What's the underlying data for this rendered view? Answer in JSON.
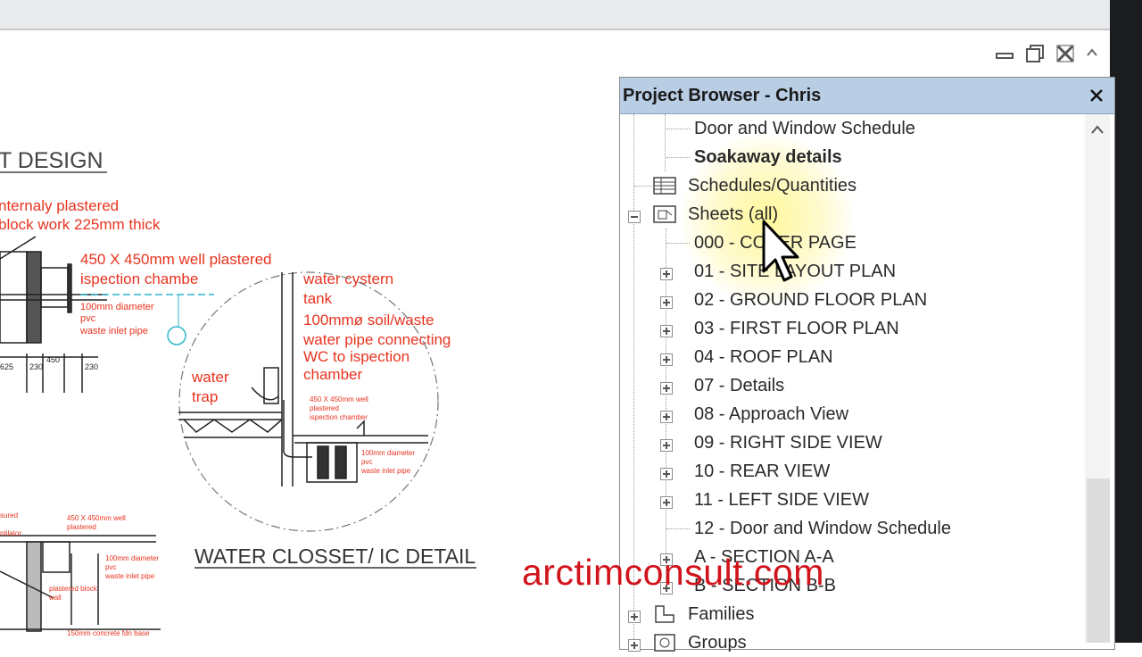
{
  "drawing": {
    "title_partial": "T DESIGN",
    "notes": [
      "nternaly plastered",
      "block work 225mm thick",
      "450 X 450mm well plastered",
      "ispection chambe",
      "100mm diameter",
      "pvc",
      "waste inlet pipe",
      "water cystern",
      "tank",
      "100mmø soil/waste",
      "water pipe connecting",
      "WC to ispection",
      "chamber",
      "water",
      "trap",
      "450 X 450mm well",
      "plastered",
      "ispection chamber",
      "100mm diameter",
      "pvc",
      "waste inlet pipe"
    ],
    "detail_title": "WATER CLOSSET/ IC DETAIL",
    "dims": [
      "625",
      "230",
      "450",
      "230"
    ]
  },
  "project_browser": {
    "title": "Project Browser - Chris",
    "items": [
      {
        "label": "Door and Window Schedule"
      },
      {
        "label": "Soakaway details"
      },
      {
        "label": "Schedules/Quantities"
      },
      {
        "label": "Sheets (all)"
      },
      {
        "label": "000 - COVER PAGE"
      },
      {
        "label": "01 - SITE LAYOUT PLAN"
      },
      {
        "label": "02 - GROUND FLOOR PLAN"
      },
      {
        "label": "03 - FIRST FLOOR PLAN"
      },
      {
        "label": "04 - ROOF PLAN"
      },
      {
        "label": "07 - Details"
      },
      {
        "label": "08 - Approach View"
      },
      {
        "label": "09 - RIGHT SIDE VIEW"
      },
      {
        "label": "10 - REAR VIEW"
      },
      {
        "label": "11 - LEFT SIDE VIEW"
      },
      {
        "label": "12 - Door and Window Schedule"
      },
      {
        "label": "A - SECTION A-A"
      },
      {
        "label": "B - SECTION B-B"
      },
      {
        "label": "Families"
      },
      {
        "label": "Groups"
      }
    ]
  },
  "watermark": "arctimconsult.com"
}
